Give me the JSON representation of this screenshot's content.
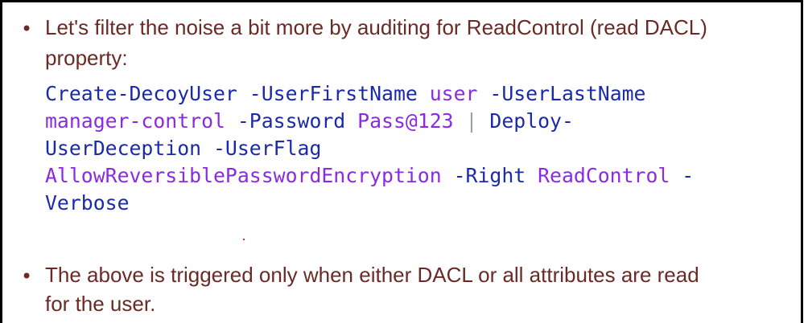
{
  "slide": {
    "bullet_glyph": "•",
    "bullet1": {
      "line1": "Let's filter the noise a bit more by auditing for ReadControl (read DACL)",
      "line2": "property:"
    },
    "code": {
      "l1_cmd1": "Create-DecoyUser",
      "l1_p1": " -UserFirstName ",
      "l1_a1": "user",
      "l1_p2": " -UserLastName",
      "l2_a1": "manager-control",
      "l2_p1": " -Password ",
      "l2_a2": "Pass@123",
      "l2_pipe": " | ",
      "l2_cmd2": "Deploy-",
      "l3_cmd": "UserDeception",
      "l3_p1": " -UserFlag",
      "l4_a1": "AllowReversiblePasswordEncryption",
      "l4_p1": " -Right ",
      "l4_a2": "ReadControl",
      "l4_p2": " -",
      "l5_p1": "Verbose"
    },
    "bullet2": {
      "line1": "The above is triggered only when either DACL or all attributes are read",
      "line2": "for the user."
    },
    "colors": {
      "text": "#6b2a25",
      "command": "#1b2aa8",
      "argument": "#8a2be2",
      "pipe": "#9aa0a6",
      "border": "#000000"
    }
  }
}
